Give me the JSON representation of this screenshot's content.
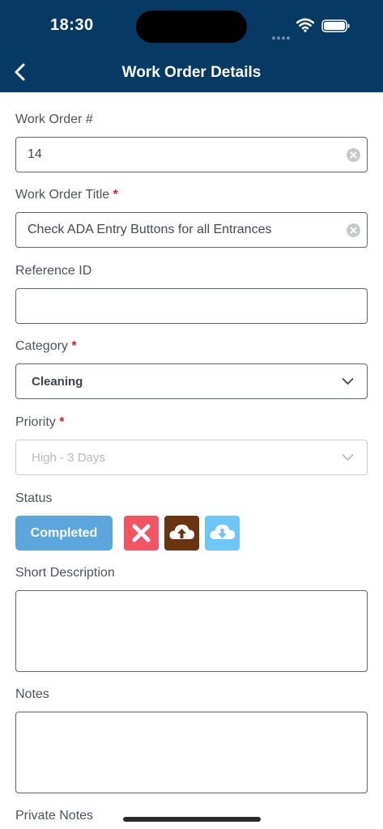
{
  "status_bar": {
    "time": "18:30"
  },
  "header": {
    "title": "Work Order Details"
  },
  "form": {
    "work_order_number": {
      "label": "Work Order #",
      "value": "14"
    },
    "work_order_title": {
      "label": "Work Order Title",
      "required_mark": "*",
      "value": "Check ADA Entry Buttons for all Entrances"
    },
    "reference_id": {
      "label": "Reference ID",
      "value": ""
    },
    "category": {
      "label": "Category",
      "required_mark": "*",
      "value": "Cleaning"
    },
    "priority": {
      "label": "Priority",
      "required_mark": "*",
      "value": "High - 3 Days"
    },
    "status": {
      "label": "Status",
      "value": "Completed"
    },
    "short_description": {
      "label": "Short Description",
      "value": ""
    },
    "notes": {
      "label": "Notes",
      "value": ""
    },
    "private_notes": {
      "label": "Private Notes"
    }
  },
  "status_actions": [
    {
      "icon": "close-icon",
      "color": "#f25561"
    },
    {
      "icon": "cloud-upload-icon",
      "color": "#6b3411"
    },
    {
      "icon": "cloud-download-icon",
      "color": "#6cc6f7"
    }
  ],
  "colors": {
    "header": "#063a64",
    "status_button": "#5ba6dc",
    "required": "#d32323"
  }
}
